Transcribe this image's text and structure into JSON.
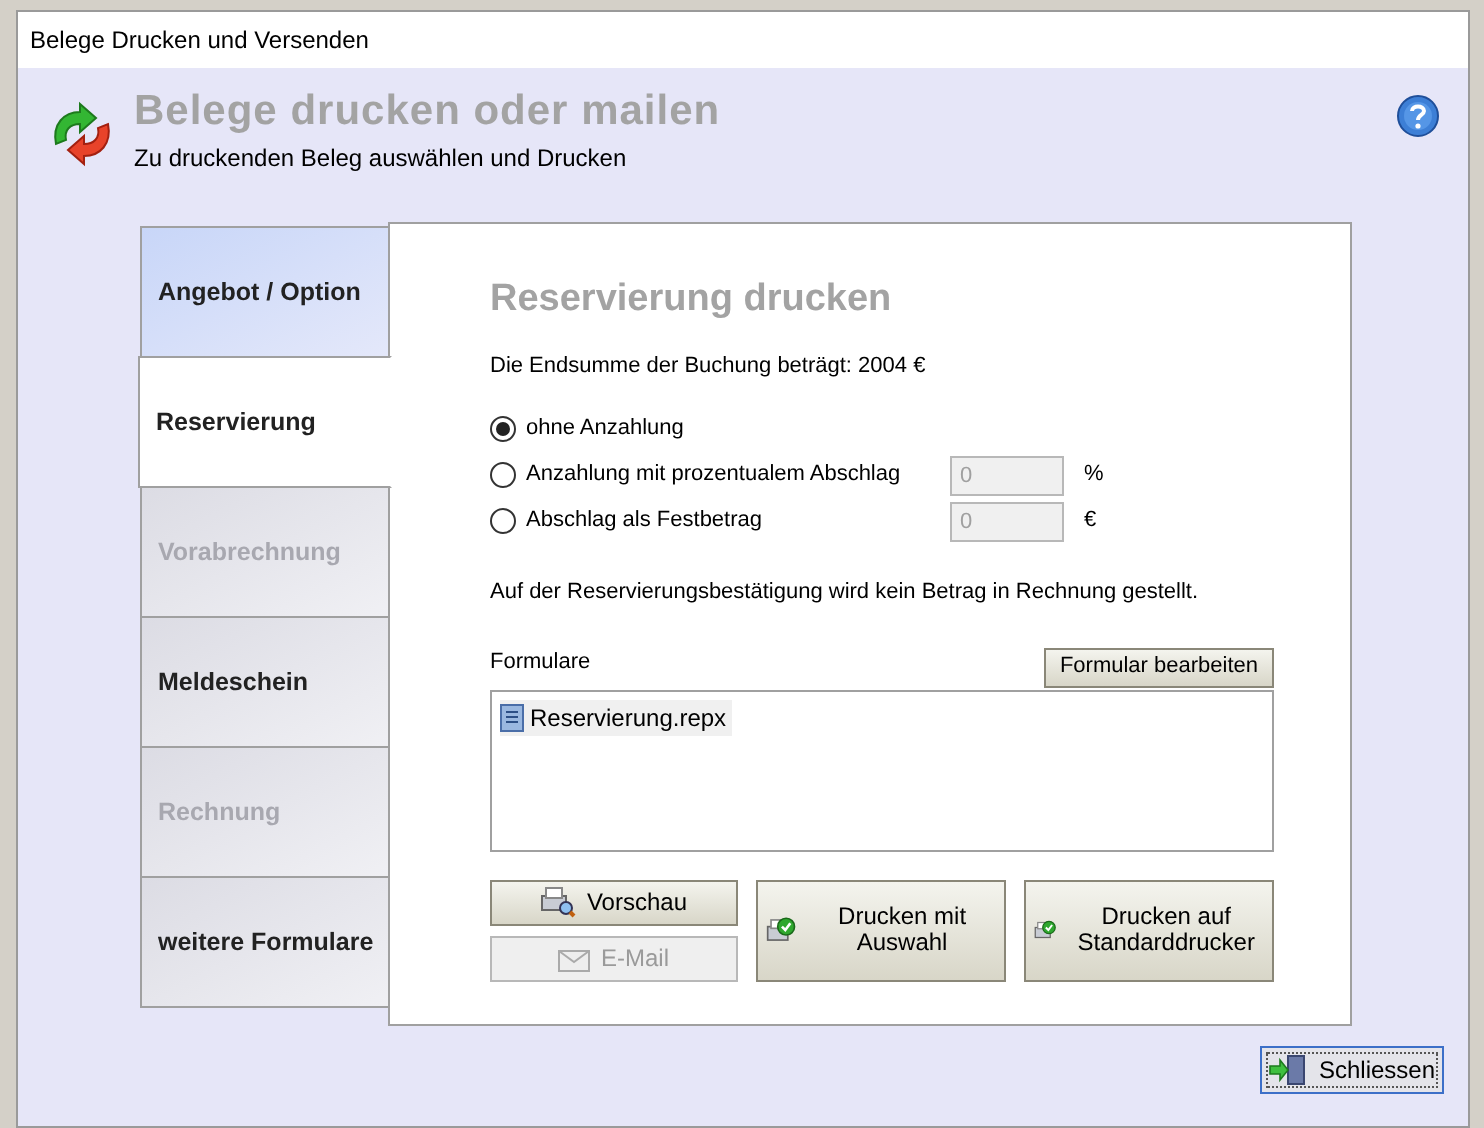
{
  "window": {
    "title": "Belege Drucken und Versenden"
  },
  "header": {
    "title": "Belege drucken oder mailen",
    "subtitle": "Zu druckenden Beleg auswählen und Drucken"
  },
  "tabs": [
    {
      "label": "Angebot / Option",
      "selected": false,
      "disabled": false,
      "hovered": true
    },
    {
      "label": "Reservierung",
      "selected": true,
      "disabled": false,
      "hovered": false
    },
    {
      "label": "Vorabrechnung",
      "selected": false,
      "disabled": true,
      "hovered": false
    },
    {
      "label": "Meldeschein",
      "selected": false,
      "disabled": false,
      "hovered": false
    },
    {
      "label": "Rechnung",
      "selected": false,
      "disabled": true,
      "hovered": false
    },
    {
      "label": "weitere Formulare",
      "selected": false,
      "disabled": false,
      "hovered": false
    }
  ],
  "panel": {
    "title": "Reservierung drucken",
    "total": "Die Endsumme der Buchung beträgt: 2004 €",
    "options": [
      {
        "label": "ohne Anzahlung",
        "selected": true
      },
      {
        "label": "Anzahlung mit prozentualem Abschlag",
        "selected": false,
        "value": "0",
        "unit": "%"
      },
      {
        "label": "Abschlag als Festbetrag",
        "selected": false,
        "value": "0",
        "unit": "€"
      }
    ],
    "notice": "Auf der Reservierungsbestätigung wird kein Betrag in Rechnung gestellt.",
    "forms_label": "Formulare",
    "edit_button": "Formular bearbeiten",
    "forms": [
      {
        "label": "Reservierung.repx",
        "selected": true
      }
    ],
    "buttons": [
      {
        "label": "Vorschau",
        "disabled": false,
        "kind": "preview"
      },
      {
        "label": "E-Mail",
        "disabled": true,
        "kind": "mail"
      }
    ],
    "print_buttons": [
      "Drucken mit Auswahl",
      "Drucken auf Standarddrucker"
    ]
  },
  "close_button": "Schliessen"
}
